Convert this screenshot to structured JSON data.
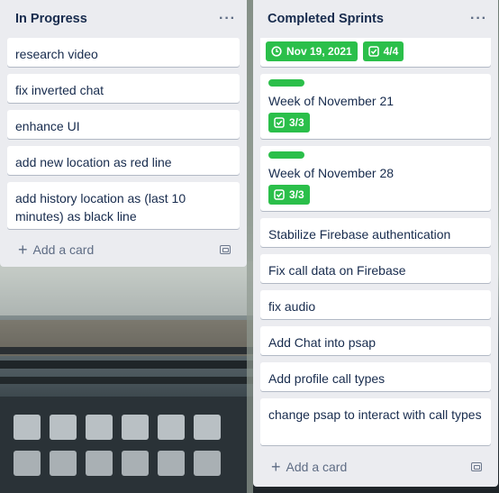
{
  "lists": [
    {
      "title": "In Progress",
      "menu": "···",
      "cards": [
        "research video",
        "fix inverted chat",
        "enhance UI",
        "add new location as red line",
        "add history location as (last 10 minutes) as black line"
      ],
      "add_card": "Add a card"
    },
    {
      "title": "Completed Sprints",
      "menu": "···",
      "top_badges": {
        "date": "Nov 19, 2021",
        "checklist": "4/4"
      },
      "label_cards": [
        {
          "title": "Week of November 21",
          "checklist": "3/3",
          "label_color": "#2bbf4a"
        },
        {
          "title": "Week of November 28",
          "checklist": "3/3",
          "label_color": "#2bbf4a"
        }
      ],
      "cards": [
        "Stabilize Firebase authentication",
        "Fix call data on Firebase",
        "fix audio",
        "Add Chat into psap",
        "Add profile call types",
        "change psap to interact with call types"
      ],
      "add_card": "Add a card"
    }
  ],
  "colors": {
    "list_bg": "#ebecf0",
    "badge_green": "#2bbf4a",
    "text": "#172b4d",
    "muted": "#5e6c84"
  },
  "icons": {
    "menu": "more-horizontal-icon",
    "date": "clock-icon",
    "checklist": "checkbox-icon",
    "add": "plus-icon",
    "template": "card-template-icon"
  }
}
